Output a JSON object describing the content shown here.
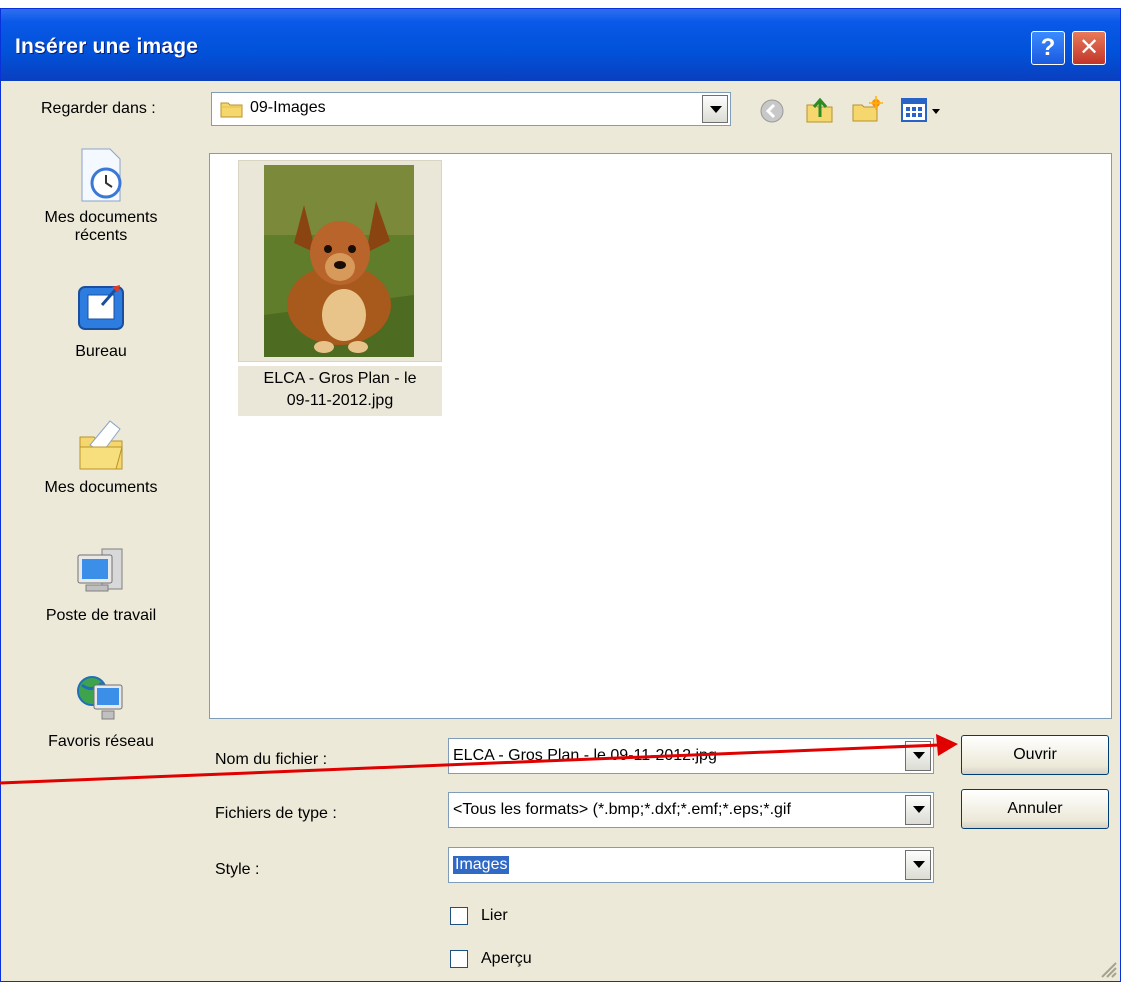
{
  "window": {
    "title": "Insérer une image",
    "help_label": "?",
    "close_label": "✕"
  },
  "look_in": {
    "label": "Regarder dans :",
    "value": "09-Images"
  },
  "toolbar": {
    "icons": [
      "back-icon",
      "up-folder-icon",
      "new-folder-icon",
      "view-menu-icon"
    ]
  },
  "sidebar": {
    "items": [
      {
        "label_line1": "Mes documents",
        "label_line2": "récents",
        "icon": "recent-documents-icon"
      },
      {
        "label_line1": "Bureau",
        "label_line2": "",
        "icon": "desktop-icon"
      },
      {
        "label_line1": "Mes documents",
        "label_line2": "",
        "icon": "my-documents-icon"
      },
      {
        "label_line1": "Poste de travail",
        "label_line2": "",
        "icon": "my-computer-icon"
      },
      {
        "label_line1": "Favoris réseau",
        "label_line2": "",
        "icon": "network-icon"
      }
    ]
  },
  "files": [
    {
      "name_line1": "ELCA - Gros Plan - le",
      "name_line2": "09-11-2012.jpg",
      "thumbnail": "dog-photo"
    }
  ],
  "form": {
    "filename_label": "Nom du fichier :",
    "filename_value": "ELCA - Gros Plan - le 09-11-2012.jpg",
    "filetype_label": "Fichiers de type :",
    "filetype_value": "<Tous les formats> (*.bmp;*.dxf;*.emf;*.eps;*.gif",
    "style_label": "Style :",
    "style_value": "Images",
    "link_label": "Lier",
    "link_checked": false,
    "preview_label": "Aperçu",
    "preview_checked": false
  },
  "buttons": {
    "open_label": "Ouvrir",
    "cancel_label": "Annuler"
  },
  "colors": {
    "titlebar": "#0152d9",
    "dialog_bg": "#ece9d8",
    "annotation_arrow": "#e00000",
    "selection": "#316ac5"
  }
}
